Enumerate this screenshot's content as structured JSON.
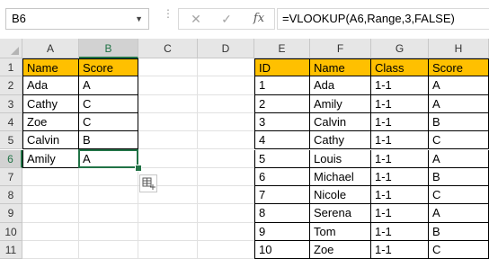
{
  "name_box": {
    "value": "B6"
  },
  "formula_bar": {
    "cancel_icon": "✕",
    "enter_icon": "✓",
    "fx_label": "fx",
    "formula": "=VLOOKUP(A6,Range,3,FALSE)"
  },
  "columns": [
    "A",
    "B",
    "C",
    "D",
    "E",
    "F",
    "G",
    "H"
  ],
  "rows": [
    "1",
    "2",
    "3",
    "4",
    "5",
    "6",
    "7",
    "8",
    "9",
    "10",
    "11"
  ],
  "selected": {
    "column": "B",
    "row": "6"
  },
  "left_table": {
    "headers": [
      "Name",
      "Score"
    ],
    "rows": [
      [
        "Ada",
        "A"
      ],
      [
        "Cathy",
        "C"
      ],
      [
        "Zoe",
        "C"
      ],
      [
        "Calvin",
        "B"
      ],
      [
        "Amily",
        "A"
      ]
    ]
  },
  "right_table": {
    "headers": [
      "ID",
      "Name",
      "Class",
      "Score"
    ],
    "rows": [
      [
        "1",
        "Ada",
        "1-1",
        "A"
      ],
      [
        "2",
        "Amily",
        "1-1",
        "A"
      ],
      [
        "3",
        "Calvin",
        "1-1",
        "B"
      ],
      [
        "4",
        "Cathy",
        "1-1",
        "C"
      ],
      [
        "5",
        "Louis",
        "1-1",
        "A"
      ],
      [
        "6",
        "Michael",
        "1-1",
        "B"
      ],
      [
        "7",
        "Nicole",
        "1-1",
        "C"
      ],
      [
        "8",
        "Serena",
        "1-1",
        "A"
      ],
      [
        "9",
        "Tom",
        "1-1",
        "B"
      ],
      [
        "10",
        "Zoe",
        "1-1",
        "C"
      ]
    ]
  },
  "colors": {
    "header_fill": "#ffc000",
    "selection": "#217346"
  },
  "icons": {
    "quick_analysis": "quick-analysis-icon",
    "name_box_dropdown": "chevron-down-icon"
  }
}
